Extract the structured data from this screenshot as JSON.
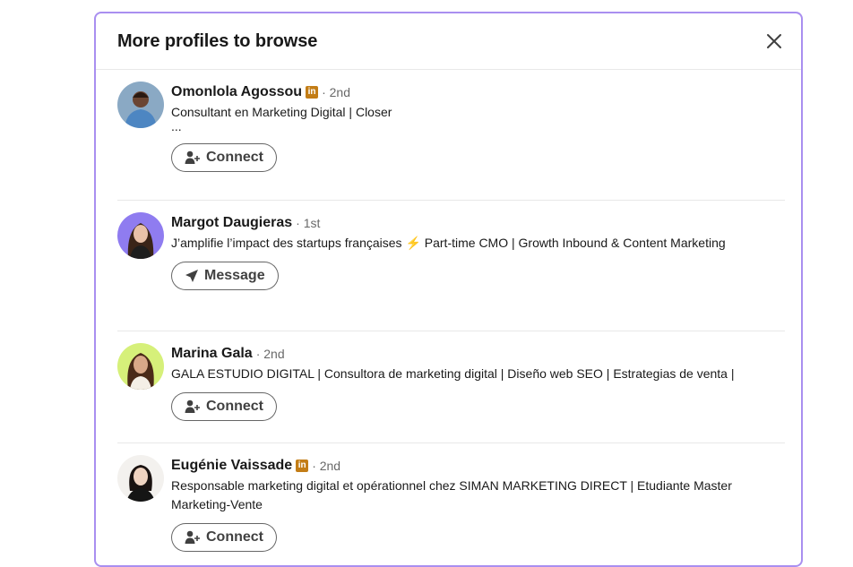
{
  "modal": {
    "title": "More profiles to browse",
    "close_icon": "close-icon"
  },
  "profiles": [
    {
      "name": "Omonlola Agossou",
      "premium_badge": "in",
      "degree": "· 2nd",
      "headline": "Consultant en Marketing Digital | Closer",
      "more": "...",
      "action_label": "Connect",
      "action_icon": "add-person-icon"
    },
    {
      "name": "Margot Daugieras",
      "degree": "· 1st",
      "headline_part1": "J’amplifie l’impact des startups françaises",
      "headline_bolt": "⚡",
      "headline_part2": "Part-time CMO | Growth Inbound & Content Marketing",
      "action_label": "Message",
      "action_icon": "send-icon"
    },
    {
      "name": "Marina Gala",
      "degree": "· 2nd",
      "headline": "GALA ESTUDIO DIGITAL | Consultora de marketing digital | Diseño web SEO | Estrategias de venta |",
      "action_label": "Connect",
      "action_icon": "add-person-icon"
    },
    {
      "name": "Eugénie Vaissade",
      "premium_badge": "in",
      "degree": "· 2nd",
      "headline": "Responsable marketing digital et opérationnel chez SIMAN MARKETING DIRECT | Etudiante Master Marketing-Vente",
      "action_label": "Connect",
      "action_icon": "add-person-icon"
    }
  ],
  "colors": {
    "modal_border": "#a98ff0",
    "premium_badge": "#c37d16",
    "divider": "#e8e8e8"
  }
}
